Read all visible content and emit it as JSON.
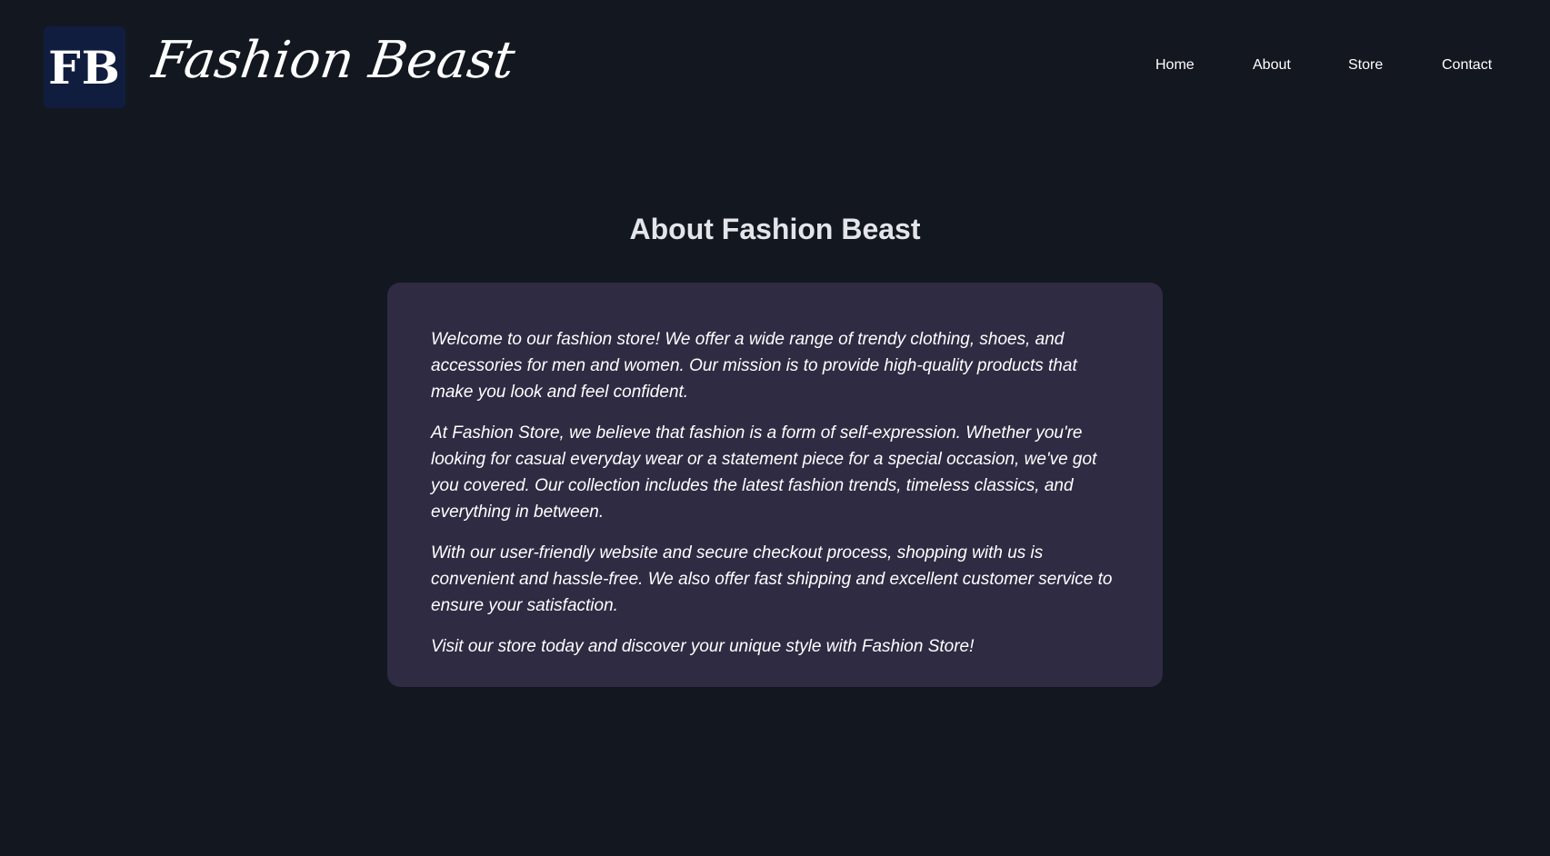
{
  "colors": {
    "page_background": "#131720",
    "logo_background": "#111d3f",
    "card_background": "#2f2b43",
    "text": "#ffffff",
    "title_text": "#e3e5ea"
  },
  "header": {
    "logo_text": "FB",
    "brand_name": "Fashion Beast"
  },
  "nav": {
    "home": "Home",
    "about": "About",
    "store": "Store",
    "contact": "Contact"
  },
  "main": {
    "title": "About Fashion Beast",
    "paragraphs": [
      "Welcome to our fashion store! We offer a wide range of trendy clothing, shoes, and accessories for men and women. Our mission is to provide high-quality products that make you look and feel confident.",
      "At Fashion Store, we believe that fashion is a form of self-expression. Whether you're looking for casual everyday wear or a statement piece for a special occasion, we've got you covered. Our collection includes the latest fashion trends, timeless classics, and everything in between.",
      "With our user-friendly website and secure checkout process, shopping with us is convenient and hassle-free. We also offer fast shipping and excellent customer service to ensure your satisfaction.",
      "Visit our store today and discover your unique style with Fashion Store!"
    ]
  }
}
